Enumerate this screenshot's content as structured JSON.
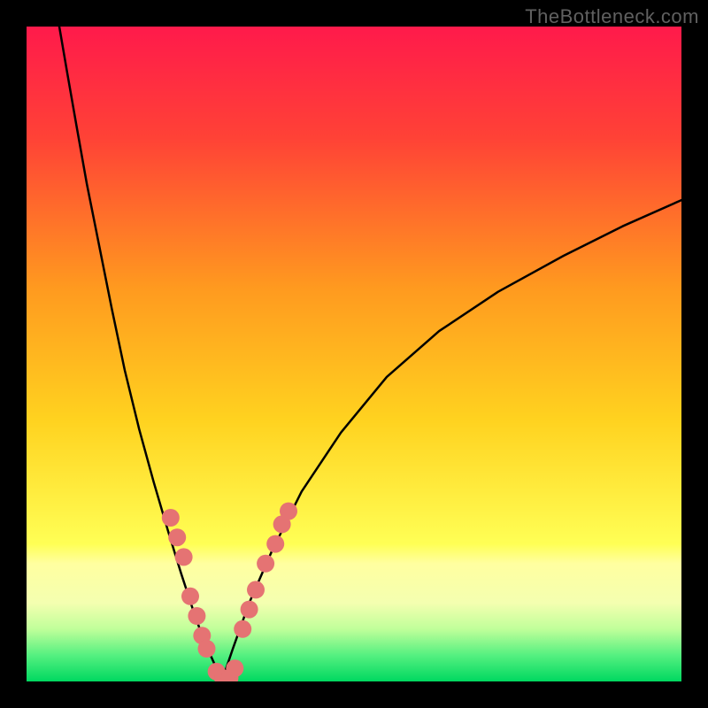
{
  "watermark": "TheBottleneck.com",
  "chart_data": {
    "type": "line",
    "title": "",
    "xlabel": "",
    "ylabel": "",
    "xlim": [
      0,
      100
    ],
    "ylim": [
      0,
      100
    ],
    "grid": false,
    "background_gradient": {
      "stops": [
        {
          "offset": 0.0,
          "color": "#ff1a4b"
        },
        {
          "offset": 0.17,
          "color": "#ff4236"
        },
        {
          "offset": 0.4,
          "color": "#ff9a1f"
        },
        {
          "offset": 0.6,
          "color": "#ffd21f"
        },
        {
          "offset": 0.79,
          "color": "#ffff55"
        },
        {
          "offset": 0.82,
          "color": "#ffffa0"
        },
        {
          "offset": 0.88,
          "color": "#f4ffb0"
        },
        {
          "offset": 0.92,
          "color": "#c0ff9a"
        },
        {
          "offset": 0.96,
          "color": "#55f080"
        },
        {
          "offset": 1.0,
          "color": "#00d860"
        }
      ]
    },
    "series": [
      {
        "name": "curve-left",
        "x": [
          5,
          6.2,
          7.6,
          9.2,
          11,
          13,
          15,
          17.2,
          19.4,
          21.6,
          23.6,
          25.4,
          26.8,
          28,
          29,
          29.8
        ],
        "y": [
          100,
          93,
          85,
          76,
          67,
          57,
          47.5,
          38.5,
          30.5,
          23,
          16.5,
          11,
          7,
          4.2,
          2,
          0
        ]
      },
      {
        "name": "curve-right",
        "x": [
          29.8,
          31.5,
          34,
          37.5,
          42,
          48,
          55,
          63,
          72,
          82,
          91,
          100
        ],
        "y": [
          0,
          5,
          12,
          20,
          29,
          38,
          46.5,
          53.5,
          59.5,
          65,
          69.5,
          73.5
        ]
      }
    ],
    "markers": {
      "name": "data-points",
      "color": "#e57373",
      "radius_screen_px": 10,
      "points": [
        {
          "x": 22,
          "y": 25
        },
        {
          "x": 23,
          "y": 22
        },
        {
          "x": 24,
          "y": 19
        },
        {
          "x": 25,
          "y": 13
        },
        {
          "x": 26,
          "y": 10
        },
        {
          "x": 26.8,
          "y": 7
        },
        {
          "x": 27.5,
          "y": 5
        },
        {
          "x": 29,
          "y": 1.5
        },
        {
          "x": 30,
          "y": 0.5
        },
        {
          "x": 31,
          "y": 0.5
        },
        {
          "x": 31.8,
          "y": 2
        },
        {
          "x": 33,
          "y": 8
        },
        {
          "x": 34,
          "y": 11
        },
        {
          "x": 35,
          "y": 14
        },
        {
          "x": 36.5,
          "y": 18
        },
        {
          "x": 38,
          "y": 21
        },
        {
          "x": 39,
          "y": 24
        },
        {
          "x": 40,
          "y": 26
        }
      ]
    }
  }
}
